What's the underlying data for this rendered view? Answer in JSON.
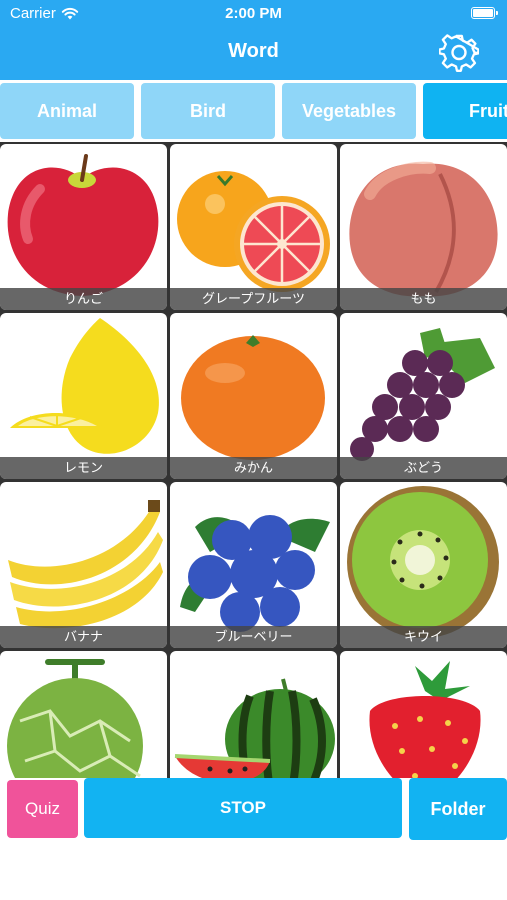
{
  "status_bar": {
    "carrier": "Carrier",
    "time": "2:00 PM",
    "wifi_icon": "wifi-icon",
    "battery_icon": "battery-icon"
  },
  "nav": {
    "title": "Word",
    "settings_icon": "gear-icon"
  },
  "tabs": [
    {
      "label": "Animal",
      "active": false
    },
    {
      "label": "Bird",
      "active": false
    },
    {
      "label": "Vegetables",
      "active": false
    },
    {
      "label": "Fruit",
      "active": true
    }
  ],
  "cards": [
    {
      "label": "りんご",
      "picture": "apple"
    },
    {
      "label": "グレープフルーツ",
      "picture": "grapefruit"
    },
    {
      "label": "もも",
      "picture": "peach"
    },
    {
      "label": "レモン",
      "picture": "lemon"
    },
    {
      "label": "みかん",
      "picture": "mandarin"
    },
    {
      "label": "ぶどう",
      "picture": "grapes"
    },
    {
      "label": "バナナ",
      "picture": "banana"
    },
    {
      "label": "ブルーベリー",
      "picture": "blueberry"
    },
    {
      "label": "キウイ",
      "picture": "kiwi"
    },
    {
      "label": "",
      "picture": "melon"
    },
    {
      "label": "",
      "picture": "watermelon"
    },
    {
      "label": "",
      "picture": "strawberry"
    }
  ],
  "bottom_bar": {
    "quiz_label": "Quiz",
    "stop_label": "STOP",
    "folder_label": "Folder"
  },
  "colors": {
    "header": "#2aa9f2",
    "tab_inactive": "#8fd6f8",
    "tab_active": "#0fb3f2",
    "quiz": "#f0539a",
    "primary_button": "#12b3f2"
  }
}
